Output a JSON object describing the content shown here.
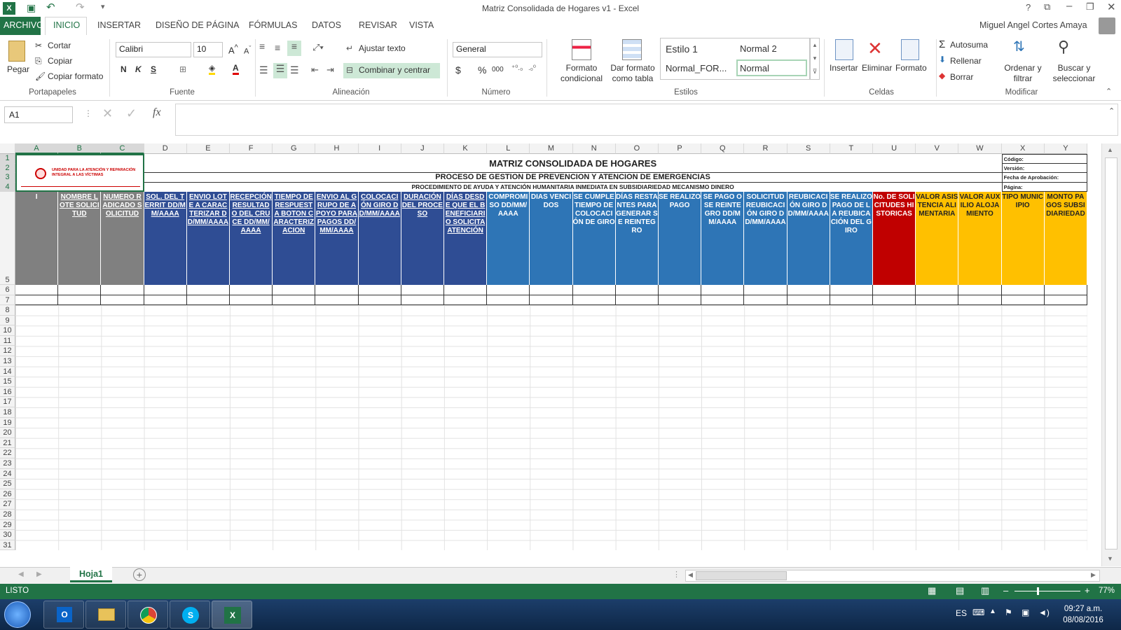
{
  "window": {
    "title": "Matriz Consolidada de Hogares v1 - Excel"
  },
  "tabs": [
    "ARCHIVO",
    "INICIO",
    "INSERTAR",
    "DISEÑO DE PÁGINA",
    "FÓRMULAS",
    "DATOS",
    "REVISAR",
    "VISTA"
  ],
  "user": "Miguel Angel Cortes Amaya",
  "ribbon": {
    "clipboard": {
      "paste": "Pegar",
      "cut": "Cortar",
      "copy": "Copiar",
      "format_painter": "Copiar formato",
      "label": "Portapapeles"
    },
    "font": {
      "name": "Calibri",
      "size": "10",
      "bold": "N",
      "italic": "K",
      "underline": "S",
      "label": "Fuente"
    },
    "alignment": {
      "wrap": "Ajustar texto",
      "merge": "Combinar y centrar",
      "label": "Alineación"
    },
    "number": {
      "format": "General",
      "currency": "$",
      "percent": "%",
      "thousands": "000",
      "label": "Número"
    },
    "styles": {
      "conditional": "Formato condicional",
      "as_table": "Dar formato como tabla",
      "s1": "Estilo 1",
      "s2": "Normal 2",
      "s3": "Normal_FOR...",
      "s4": "Normal",
      "label": "Estilos"
    },
    "cells": {
      "insert": "Insertar",
      "delete": "Eliminar",
      "format": "Formato",
      "label": "Celdas"
    },
    "editing": {
      "autosum": "Autosuma",
      "fill": "Rellenar",
      "clear": "Borrar",
      "sort": "Ordenar y filtrar",
      "find": "Buscar y seleccionar",
      "label": "Modificar"
    }
  },
  "formula": {
    "namebox": "A1",
    "fx": "fx"
  },
  "columns": [
    "A",
    "B",
    "C",
    "D",
    "E",
    "F",
    "G",
    "H",
    "I",
    "J",
    "K",
    "L",
    "M",
    "N",
    "O",
    "P",
    "Q",
    "R",
    "S",
    "T",
    "U",
    "V",
    "W",
    "X",
    "Y"
  ],
  "rows": [
    "1",
    "2",
    "3",
    "4",
    "5",
    "6",
    "7",
    "8",
    "9",
    "10",
    "11",
    "12",
    "13",
    "14",
    "15",
    "16",
    "17",
    "18",
    "19",
    "20",
    "21",
    "22",
    "23",
    "24",
    "25",
    "26",
    "27",
    "28",
    "29",
    "30",
    "31"
  ],
  "logo_text": "UNIDAD PARA LA ATENCIÓN Y REPARACIÓN INTEGRAL A LAS VÍCTIMAS",
  "sheet_title": "MATRIZ CONSOLIDADA DE HOGARES",
  "sheet_subtitle": "PROCESO DE GESTION DE PREVENCION Y ATENCION DE EMERGENCIAS",
  "sheet_subtitle2": "PROCEDIMIENTO DE AYUDA Y ATENCIÓN HUMANITARIA INMEDIATA EN SUBSIDIARIEDAD MECANISMO DINERO",
  "meta": [
    "Código:",
    "Versión:",
    "Fecha de Aprobación:",
    "Página:"
  ],
  "headers": [
    {
      "t": "I",
      "c": "#808080",
      "u": false
    },
    {
      "t": "NOMBRE LOTE SOLICITUD",
      "c": "#808080",
      "u": true
    },
    {
      "t": "NUMERO RADICADO SOLICITUD",
      "c": "#808080",
      "u": true
    },
    {
      "t": "SOL. DEL TERRIT DD/MM/AAAA",
      "c": "#2f4d94",
      "u": true
    },
    {
      "t": "ENVIO LOTE A CARACTERIZAR DD/MM/AAAA",
      "c": "#2f4d94",
      "u": true
    },
    {
      "t": "RECEPCIÓN RESULTADO DEL CRUCE DD/MM/AAAA",
      "c": "#2f4d94",
      "u": true
    },
    {
      "t": "TIEMPO DE RESPUESTA BOTON CARACTERIZACION",
      "c": "#2f4d94",
      "u": true
    },
    {
      "t": "ENVIO AL GRUPO DE APOYO PARA PAGOS DD/MM/AAAA",
      "c": "#2f4d94",
      "u": true
    },
    {
      "t": "COLOCACIÓN GIRO DD/MM/AAAA",
      "c": "#2f4d94",
      "u": true
    },
    {
      "t": "DURACIÓN DEL PROCESO",
      "c": "#2f4d94",
      "u": true
    },
    {
      "t": "DÍAS DESDE QUE EL BENEFICIARIO SOLICITA ATENCIÓN",
      "c": "#2f4d94",
      "u": true
    },
    {
      "t": "COMPROMISO DD/MM/AAAA",
      "c": "#2e75b6",
      "u": false
    },
    {
      "t": "DIAS VENCIDOS",
      "c": "#2e75b6",
      "u": false
    },
    {
      "t": "SE CUMPLE TIEMPO DE COLOCACIÓN DE GIRO",
      "c": "#2e75b6",
      "u": false
    },
    {
      "t": "DÍAS RESTANTES PARA GENERAR SE REINTEGRO",
      "c": "#2e75b6",
      "u": false
    },
    {
      "t": "SE REALIZO PAGO",
      "c": "#2e75b6",
      "u": false
    },
    {
      "t": "SE PAGO O SE REINTEGRO DD/MM/AAAA",
      "c": "#2e75b6",
      "u": false
    },
    {
      "t": "SOLICITUD REUBICACIÓN GIRO DD/MM/AAAA",
      "c": "#2e75b6",
      "u": false
    },
    {
      "t": "REUBICACIÓN GIRO DD/MM/AAAA",
      "c": "#2e75b6",
      "u": false
    },
    {
      "t": "SE REALIZO PAGO DE LA REUBICACIÓN DEL GIRO",
      "c": "#2e75b6",
      "u": false
    },
    {
      "t": "No. DE SOLICITUDES HISTORICAS",
      "c": "#c00000",
      "u": false
    },
    {
      "t": "VALOR ASISTENCIA ALIMENTARIA",
      "c": "#ffc000",
      "u": false
    },
    {
      "t": "VALOR AUXILIO ALOJAMIENTO",
      "c": "#ffc000",
      "u": false
    },
    {
      "t": "TIPO MUNICIPIO",
      "c": "#ffc000",
      "u": false
    },
    {
      "t": "MONTO PAGOS SUBSIDIARIEDAD",
      "c": "#ffc000",
      "u": false
    }
  ],
  "sheet_tab": "Hoja1",
  "status": {
    "text": "LISTO",
    "zoom": "77%"
  },
  "tray": {
    "lang": "ES",
    "time": "09:27 a.m.",
    "date": "08/08/2016"
  }
}
